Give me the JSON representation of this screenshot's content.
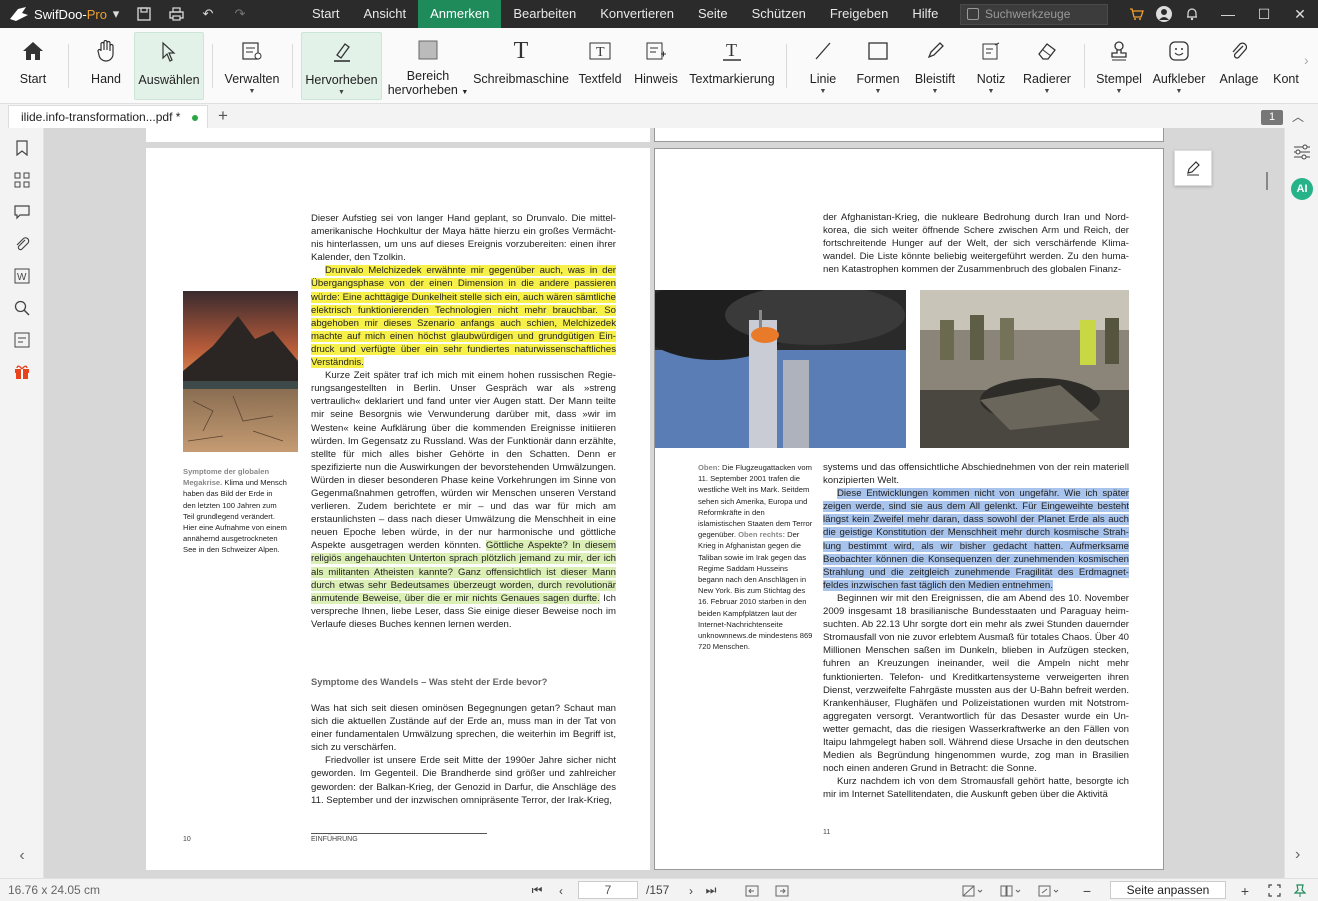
{
  "app": {
    "name_main": "SwifDoo-",
    "name_pro": "Pro"
  },
  "menu": [
    "Start",
    "Ansicht",
    "Anmerken",
    "Bearbeiten",
    "Konvertieren",
    "Seite",
    "Schützen",
    "Freigeben",
    "Hilfe"
  ],
  "menu_active": "Anmerken",
  "search": {
    "placeholder": "Suchwerkzeuge"
  },
  "tools": {
    "start": "Start",
    "hand": "Hand",
    "select": "Auswählen",
    "manage": "Verwalten",
    "highlight": "Hervorheben",
    "area_hl_1": "Bereich",
    "area_hl_2": "hervorheben",
    "typewriter": "Schreibmaschine",
    "textfield": "Textfeld",
    "note": "Hinweis",
    "textmark": "Textmarkierung",
    "line": "Linie",
    "shapes": "Formen",
    "pencil": "Bleistift",
    "notiz": "Notiz",
    "eraser": "Radierer",
    "stamp": "Stempel",
    "sticker": "Aufkleber",
    "attach": "Anlage",
    "kont": "Kont"
  },
  "tab": {
    "title": "ilide.info-transformation...pdf *"
  },
  "page_badge": "1",
  "left_page": {
    "p1": "Dieser Aufstieg sei von langer Hand geplant, so Drunvalo. Die mittel­amerikanische Hochkultur der Maya hätte hierzu ein großes Vermächt­nis hinterlassen, um uns auf dieses Ereignis vorzubereiten: einen ihrer Kalender, den Tzolkin.",
    "p2_hl": "Drunvalo Melchizedek erwähnte mir gegenüber auch, was in der Übergangsphase von der einen Dimension in die andere passieren würde: Eine achttägige Dunkelheit stelle sich ein, auch wären sämt­liche elektrisch funktionierenden Technologien nicht mehr brauchbar. So abgehoben mir dieses Szenario anfangs auch schien, Melchizedek machte auf mich einen höchst glaubwürdigen und grundgütigen Ein­druck und verfügte über ein sehr fundiertes naturwissenschaftliches Verständnis.",
    "p3_a": "Kurze Zeit später traf ich mich mit einem hohen russischen Regie­rungsangestellten in Berlin. Unser Gespräch war als »streng vertraulich« deklariert und fand unter vier Augen statt. Der Mann teilte mir seine Besorgnis wie Verwunderung darüber mit, dass »wir im Westen« keine Aufklärung über die kommenden Ereignisse initiieren würden. Im Ge­gensatz zu Russland. Was der Funktionär dann erzählte, stellte für mich alles bisher Gehörte in den Schatten. Denn er spezifizierte nun die Auswirkungen der bevorstehenden Umwälzungen. Würden in dieser besonderen Phase keine Vorkehrungen im Sinne von Gegenmaß­nahmen getroffen, würden wir Menschen unseren Verstand verlieren. Zudem berichtete er mir – und das war für mich am erstaunlichsten – dass nach dieser Umwälzung die Menschheit in eine neuen Epoche leben würde, in der nur harmonische und göttliche Aspekte ausgetra­gen werden könnten. ",
    "p3_hl": "Göttliche Aspekte? In diesem religiös ange­hauchten Unterton sprach plötzlich jemand zu mir, der ich als militan­ten Atheisten kannte? Ganz offensichtlich ist dieser Mann durch etwas sehr Bedeutsames überzeugt worden, durch revolutionär anmutende Beweise, über die er mir nichts Genaues sagen durfte.",
    "p3_b": " Ich verspreche Ihnen, liebe Leser, dass Sie einige dieser Beweise noch im Verlaufe die­ses Buches kennen lernen werden.",
    "heading": "Symptome des Wandels – Was steht der Erde bevor?",
    "p4": "Was hat sich seit diesen ominösen Begegnungen getan? Schaut man sich die aktuellen Zustände auf der Erde an, muss man in der Tat von einer fundamentalen Umwälzung sprechen, die weiterhin im Begriff ist, sich zu verschärfen.",
    "p5": "Friedvoller ist unsere Erde seit Mitte der 1990er Jahre sicher nicht geworden. Im Gegenteil. Die Brandherde sind größer und zahlreicher geworden: der Balkan-Krieg, der Genozid in Darfur, die Anschläge des 11. September und der inzwischen omnipräsente Terror, der Irak-Krieg,",
    "caption_title": "Symptome der globalen Megakrise.",
    "caption_body": " Klima und Mensch haben das Bild der Erde in den letzten 100 Jah­ren zum Teil grundlegend verändert. Hier eine Auf­nahme von einem annähernd ausgetrockneten See in den Schweizer Alpen.",
    "page_no": "10",
    "footer": "EINFÜHRUNG"
  },
  "right_page": {
    "p1": "der Afghanistan-Krieg, die nukleare Bedrohung durch Iran und Nord­korea, die sich weiter öffnende Schere zwischen Arm und Reich, der fortschreitende Hunger auf der Welt, der sich verschärfende Klima­wandel. Die Liste könnte beliebig weitergeführt werden. Zu den huma­nen Katastrophen kommen der Zusammenbruch des globalen Finanz-",
    "p2": "systems und das offensichtliche Abschiednehmen von der rein materiell konzipierten Welt.",
    "p3_hl": "Diese Entwicklungen kommen nicht von ungefähr. Wie ich später zeigen werde, sind sie aus dem All gelenkt. Für Eingeweihte besteht längst kein Zweifel mehr daran, dass sowohl der Planet Erde als auch die geistige Konstitution der Menschheit mehr durch kosmische Strah­lung bestimmt wird, als wir bisher gedacht hatten. Aufmerksame Beobachter können die Konsequenzen der zunehmenden kosmischen Strahlung und die zeitgleich zunehmende Fragilität des Erdmagnet­feldes inzwischen fast täglich den Medien entnehmen.",
    "p4": "Beginnen wir mit den Ereignissen, die am Abend des 10. November 2009 insgesamt 18 brasilianische Bundesstaaten und Paraguay heim­suchten. Ab 22.13 Uhr sorgte dort ein mehr als zwei Stunden dauern­der Stromausfall von nie zuvor erlebtem Ausmaß für totales Chaos. Über 40 Millionen Menschen saßen im Dunkeln, blieben in Aufzügen stecken, fuhren an Kreuzungen ineinander, weil die Ampeln nicht mehr funktionierten. Telefon- und Kreditkartensysteme verweigerten ihren Dienst, verzweifelte Fahrgäste mussten aus der U-Bahn befreit werden. Krankenhäuser, Flughäfen und Polizeistationen wurden mit Notstrom­aggregaten versorgt. Verantwortlich für das Desaster wurde ein Un­wetter gemacht, das die riesigen Wasserkraftwerke an den Fällen von Itaipu lahmgelegt haben soll. Während diese Ursache in den deutschen Medien als Begründung hingenommen wurde, zog man in Brasilien noch einen anderen Grund in Betracht: die Sonne.",
    "p5": "Kurz nachdem ich von dem Stromausfall gehört hatte, besorgte ich mir im Internet Satellitendaten, die Auskunft geben über die Aktivitä­",
    "cap_oben_t": "Oben:",
    "cap_oben": " Die Flugzeugattacken vom 11. September 2001 tra­fen die westliche Welt ins Mark. Seitdem sehen sich Amerika, Europa und Reform­kräfte in den islamistischen Staaten dem Terror gegenüber.",
    "cap_rechts_t": "Oben rechts:",
    "cap_rechts": " Der Krieg in Afghanistan gegen die Taliban sowie im Irak gegen das Re­gime Saddam Husseins begann nach den Anschlägen in New York. Bis zum Stichtag des 16. Februar 2010 starben in den beiden Kampfplätzen laut der Internet-Nachrichtenseite unknownnews.de mindestens 869 720 Menschen.",
    "page_no": "11"
  },
  "status": {
    "size": "16.76 x 24.05 cm",
    "page_current": "7",
    "page_total": "/157",
    "fit": "Seite anpassen"
  },
  "colors": {
    "accent": "#1f8a5a",
    "highlight_yellow": "#f7f048",
    "highlight_green": "#dcefb6",
    "highlight_blue": "#a9c4ec"
  }
}
